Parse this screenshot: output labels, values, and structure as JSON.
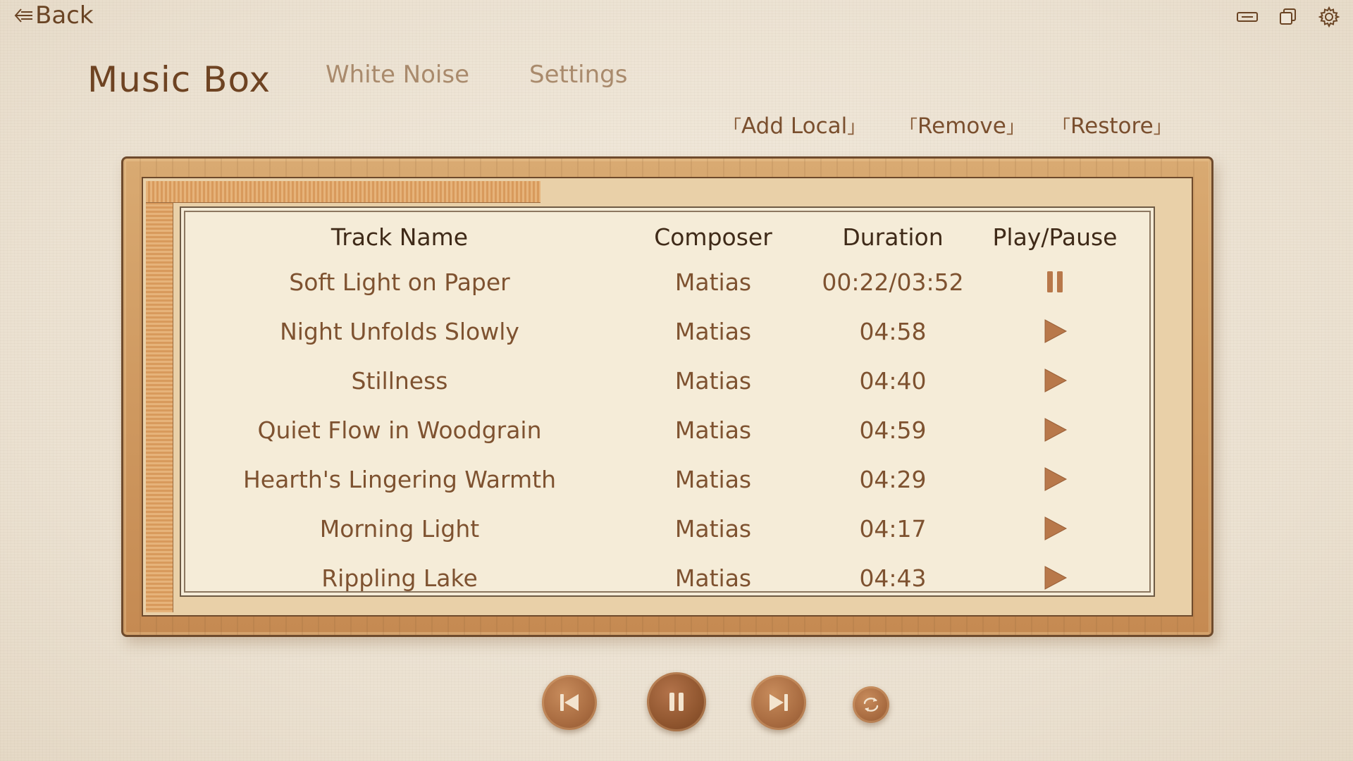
{
  "topbar": {
    "back_label": "Back",
    "back_icon": "arrow-left-icon",
    "window_controls": [
      "minimize-icon",
      "restore-icon",
      "gear-icon"
    ]
  },
  "nav": {
    "active": "Music Box",
    "tabs": [
      {
        "label": "Music Box"
      },
      {
        "label": "White Noise"
      },
      {
        "label": "Settings"
      }
    ]
  },
  "actions": {
    "add": "Add Local",
    "remove": "Remove",
    "restore": "Restore",
    "bracket_open": "「",
    "bracket_close": "」"
  },
  "table": {
    "headers": {
      "name": "Track Name",
      "composer": "Composer",
      "duration": "Duration",
      "play": "Play/Pause"
    },
    "rows": [
      {
        "name": "Soft Light on Paper",
        "composer": "Matias",
        "duration": "00:22/03:52",
        "state": "pause"
      },
      {
        "name": "Night Unfolds Slowly",
        "composer": "Matias",
        "duration": "04:58",
        "state": "play"
      },
      {
        "name": "Stillness",
        "composer": "Matias",
        "duration": "04:40",
        "state": "play"
      },
      {
        "name": "Quiet Flow in Woodgrain",
        "composer": "Matias",
        "duration": "04:59",
        "state": "play"
      },
      {
        "name": "Hearth's Lingering Warmth",
        "composer": "Matias",
        "duration": "04:29",
        "state": "play"
      },
      {
        "name": "Morning Light",
        "composer": "Matias",
        "duration": "04:17",
        "state": "play"
      },
      {
        "name": "Rippling Lake",
        "composer": "Matias",
        "duration": "04:43",
        "state": "play"
      }
    ]
  },
  "transport": {
    "buttons": [
      "previous-track-icon",
      "pause-icon",
      "next-track-icon",
      "repeat-icon"
    ]
  },
  "colors": {
    "accent": "#7a4f2e",
    "text_dark": "#3f2a18",
    "tab_inactive": "#a98a6c",
    "icon_fill": "#b8784a",
    "wood": "#cf9960",
    "paper": "#f5ecd8"
  }
}
